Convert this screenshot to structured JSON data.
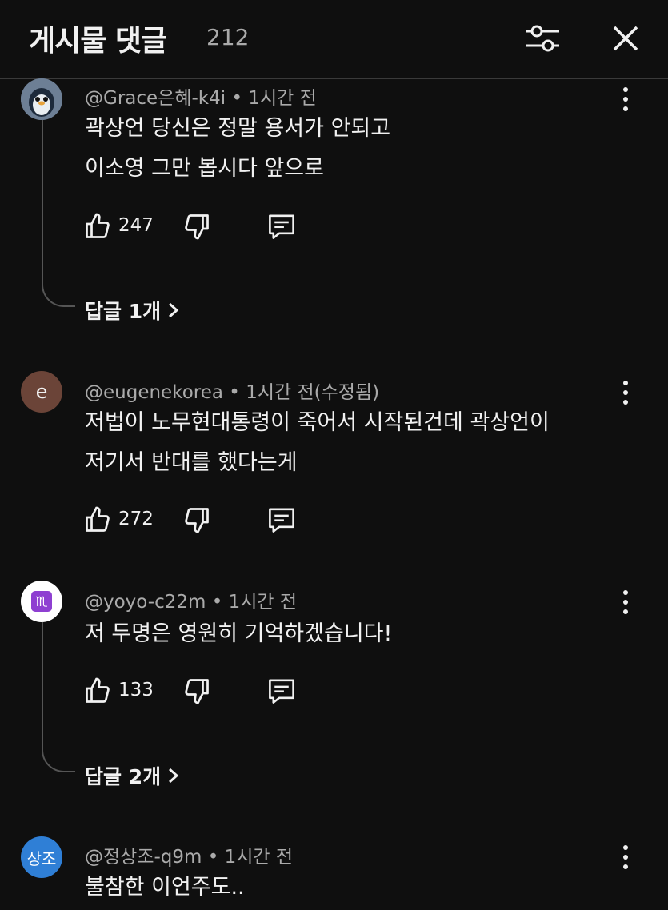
{
  "header": {
    "title": "게시물 댓글",
    "count": "212",
    "filter_icon": "sliders-icon",
    "close_icon": "close-icon"
  },
  "comments": [
    {
      "author": "@Grace은혜-k4i",
      "time": "1시간 전",
      "lines": [
        "곽상언 당신은 정말 용서가 안되고",
        "이소영 그만 봅시다 앞으로"
      ],
      "likes": "247",
      "replies": "답글 1개"
    },
    {
      "author": "@eugenekorea",
      "time": "1시간 전(수정됨)",
      "avatar_text": "e",
      "lines": [
        "저법이 노무현대통령이 죽어서 시작된건데 곽상언이",
        "저기서 반대를 했다는게"
      ],
      "likes": "272"
    },
    {
      "author": "@yoyo-c22m",
      "time": "1시간 전",
      "avatar_text": "♏",
      "lines": [
        "저 두명은 영원히 기억하겠습니다!"
      ],
      "likes": "133",
      "replies": "답글 2개"
    },
    {
      "author": "@정상조-q9m",
      "time": "1시간 전",
      "avatar_text": "상조",
      "lines": [
        "불참한 이언주도.."
      ]
    }
  ],
  "separator": "•",
  "colors": {
    "background": "#0f0f0f",
    "text": "#f1f1f1",
    "meta": "#aaaaaa",
    "avatar_e": "#6b4438",
    "avatar_jsj": "#2f7fd6",
    "avatar_yoyo_glyph": "#8e3fd1"
  }
}
